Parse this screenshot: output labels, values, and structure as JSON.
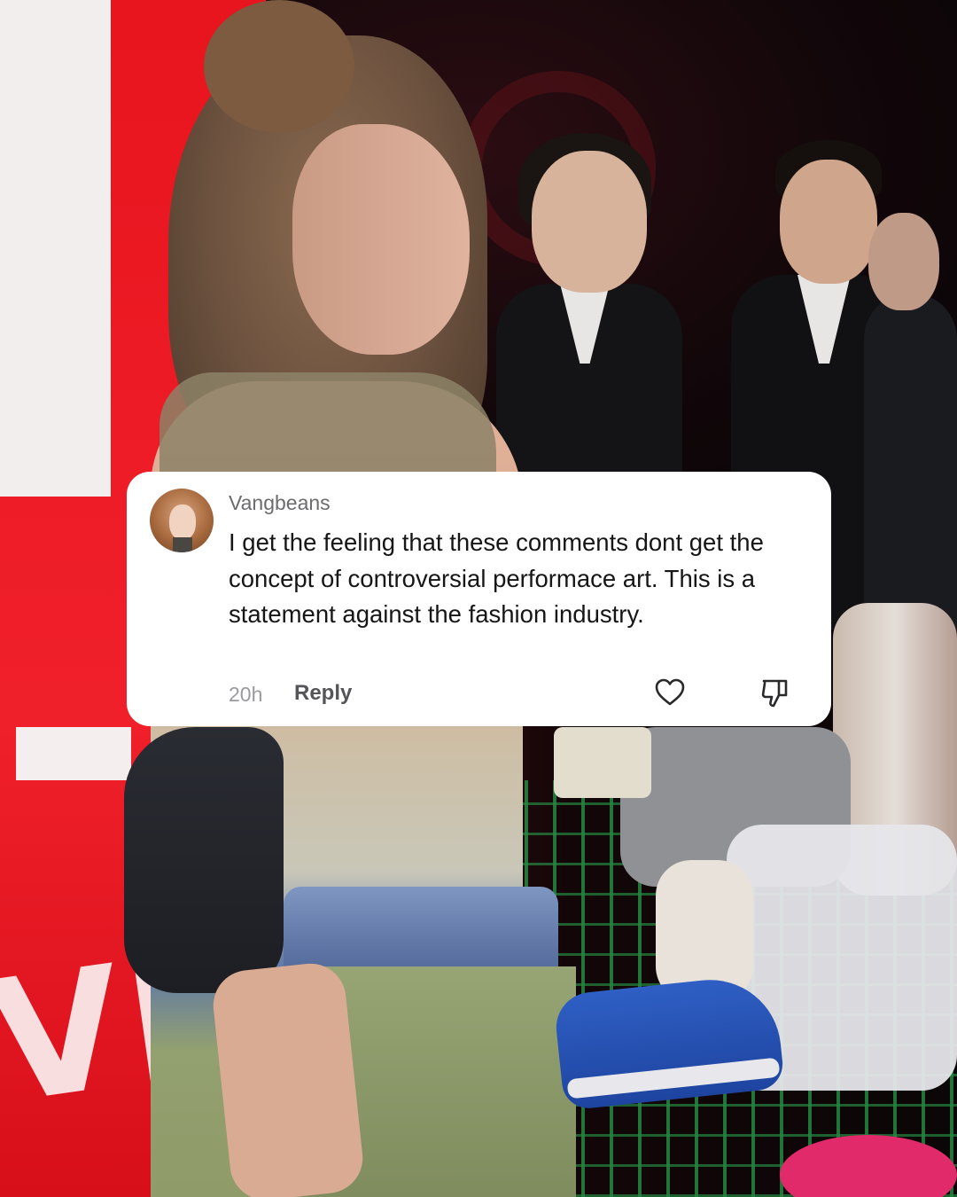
{
  "comment": {
    "username": "Vangbeans",
    "text": "I get the feeling that these comments dont get the concept of controversial performace art. This is a statement against the fashion industry.",
    "time": "20h",
    "reply_label": "Reply",
    "like_icon": "heart-outline-icon",
    "dislike_icon": "thumbs-down-outline-icon"
  },
  "background": {
    "sign_letters": "VIN",
    "accent_colors": {
      "red_wall": "#e8141e",
      "cart_green": "#289646",
      "shoe_blue": "#2f5fc4"
    }
  }
}
